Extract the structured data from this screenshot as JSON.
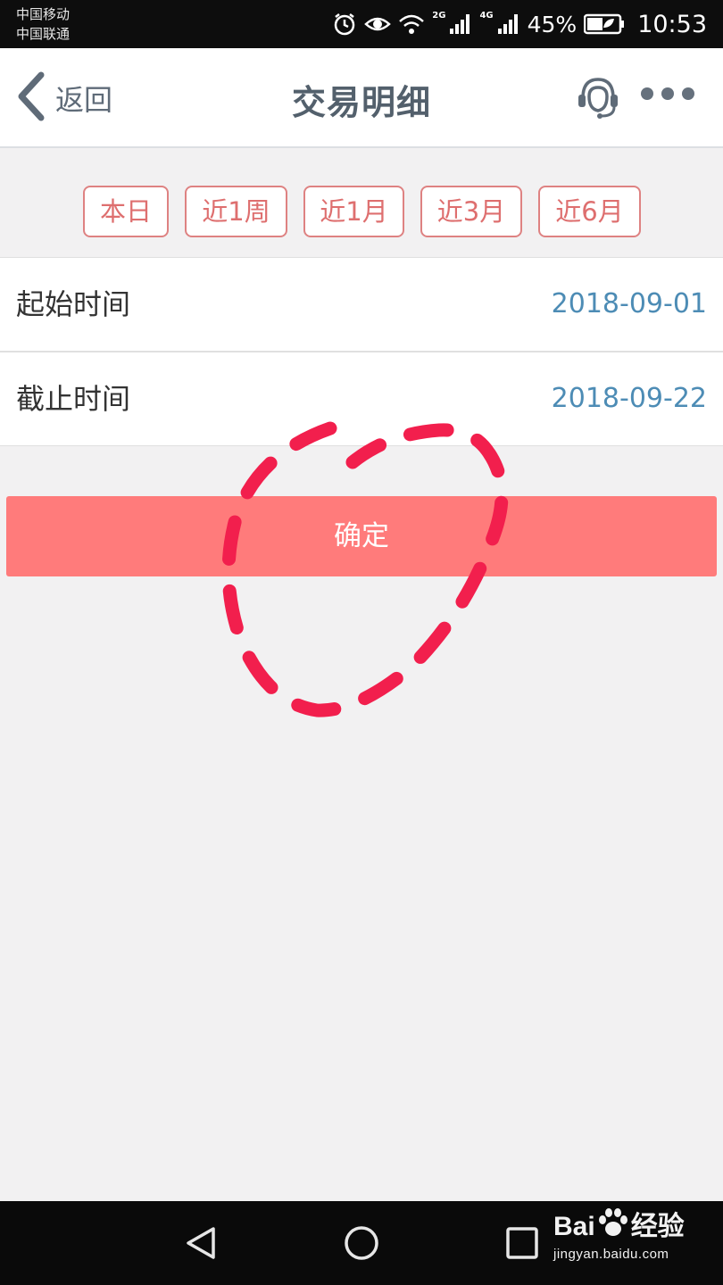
{
  "status_bar": {
    "carrier_1": "中国移动",
    "carrier_2": "中国联通",
    "net_1": "2G",
    "net_2": "4G",
    "battery": "45%",
    "time": "10:53",
    "icons": [
      "alarm-icon",
      "eye-comfort-icon",
      "wifi-icon",
      "signal-icon",
      "signal-icon",
      "battery-icon"
    ]
  },
  "header": {
    "back_label": "返回",
    "title": "交易明细",
    "icons": [
      "back-chevron-icon",
      "customer-service-icon",
      "more-icon"
    ]
  },
  "quick_ranges": [
    "本日",
    "近1周",
    "近1月",
    "近3月",
    "近6月"
  ],
  "date_range": {
    "start_label": "起始时间",
    "start_value": "2018-09-01",
    "end_label": "截止时间",
    "end_value": "2018-09-22"
  },
  "confirm_label": "确定",
  "navigation": {
    "icons": [
      "back-triangle-icon",
      "home-circle-icon",
      "recents-square-icon"
    ]
  },
  "watermark": {
    "brand_left": "Bai",
    "brand_right": "经验",
    "url": "jingyan.baidu.com"
  },
  "colors": {
    "accent": "#ff7b7b",
    "range_border": "#de8282",
    "date_value": "#4d8cb5",
    "annotation": "#f21f4d"
  }
}
